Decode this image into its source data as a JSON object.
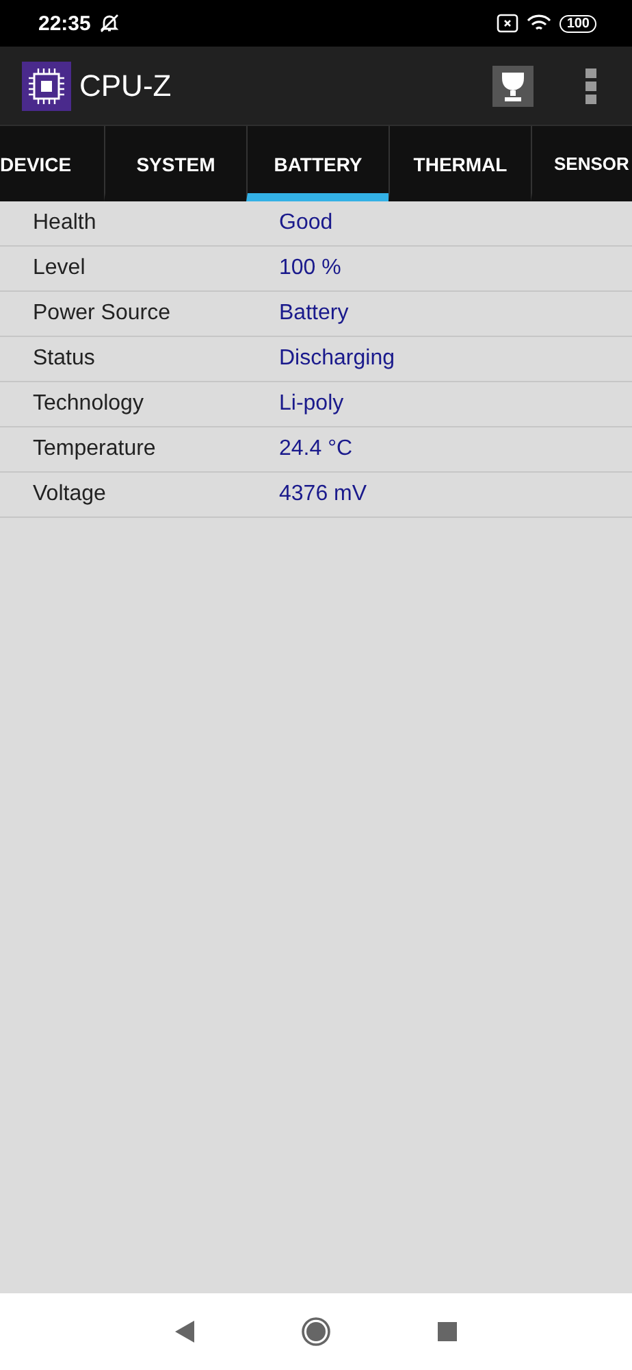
{
  "status_bar": {
    "time": "22:35",
    "battery": "100"
  },
  "app_bar": {
    "title": "CPU-Z"
  },
  "tabs": [
    {
      "label": "DEVICE",
      "selected": false
    },
    {
      "label": "SYSTEM",
      "selected": false
    },
    {
      "label": "BATTERY",
      "selected": true
    },
    {
      "label": "THERMAL",
      "selected": false
    },
    {
      "label": "SENSOR",
      "selected": false
    }
  ],
  "rows": [
    {
      "label": "Health",
      "value": "Good"
    },
    {
      "label": "Level",
      "value": "100 %"
    },
    {
      "label": "Power Source",
      "value": "Battery"
    },
    {
      "label": "Status",
      "value": "Discharging"
    },
    {
      "label": "Technology",
      "value": "Li-poly"
    },
    {
      "label": "Temperature",
      "value": "24.4 °C"
    },
    {
      "label": "Voltage",
      "value": "4376 mV"
    }
  ]
}
